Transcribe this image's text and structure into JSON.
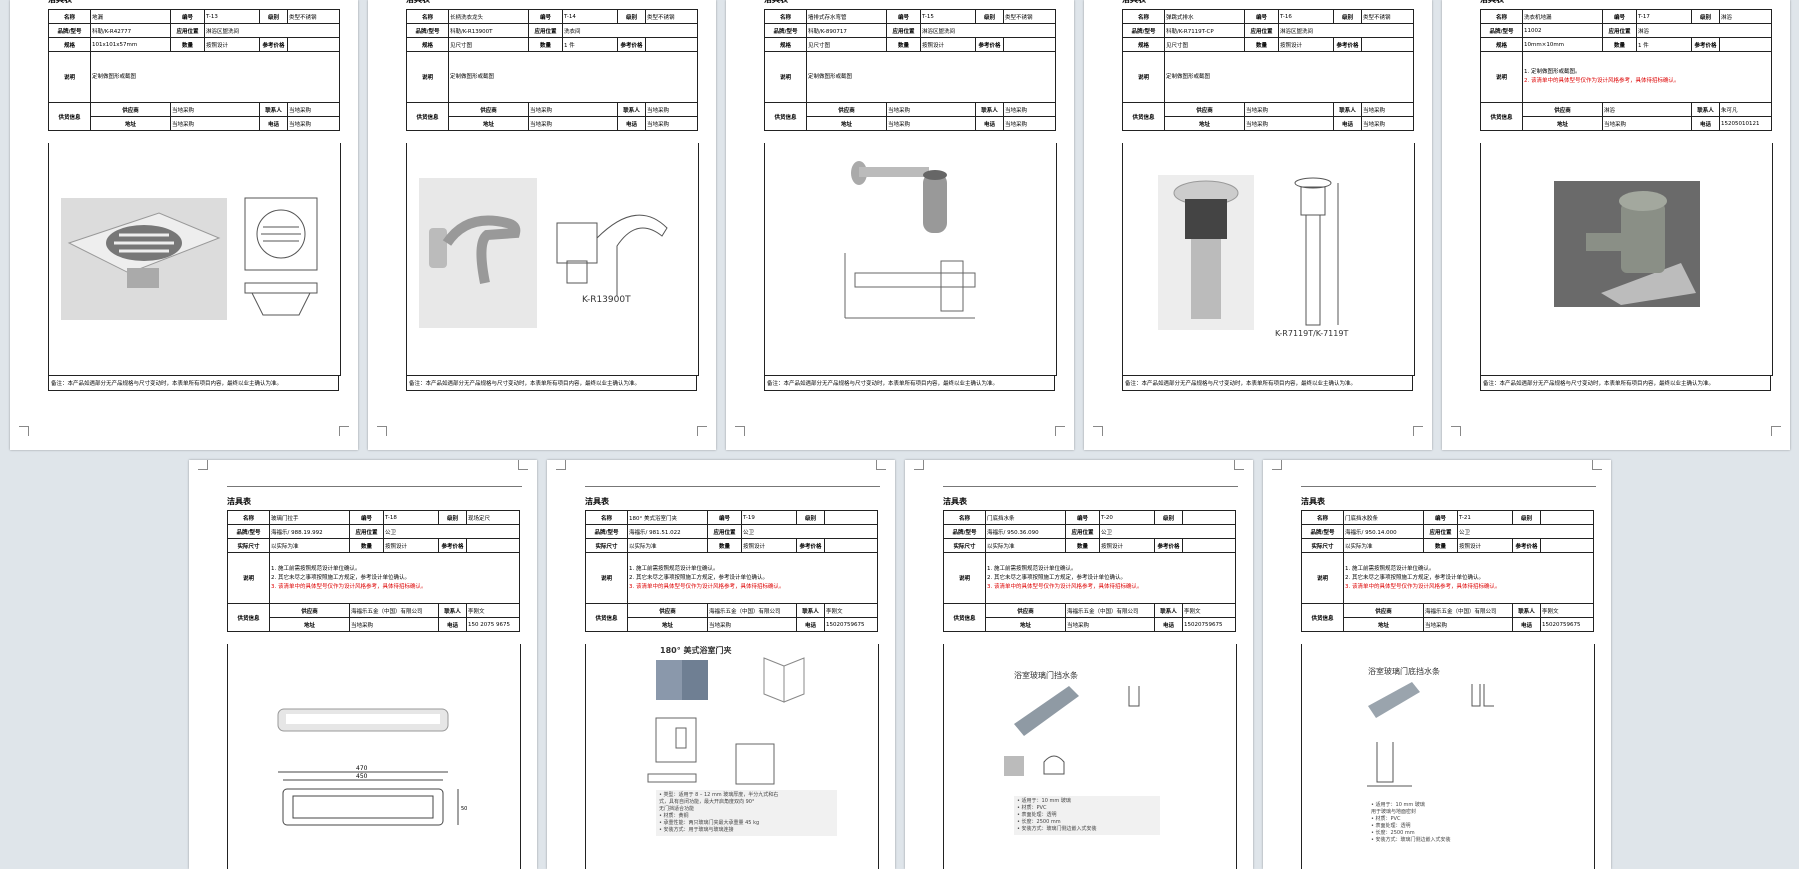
{
  "labels": {
    "name": "名称",
    "code": "编号",
    "grade": "级别",
    "model": "品牌/型号",
    "location": "应用位置",
    "size": "规格",
    "size_actual": "实际尺寸",
    "qty": "数量",
    "ref_price": "参考价格",
    "desc": "说明",
    "supplier": "供应商",
    "address": "地址",
    "contact": "联系人",
    "phone": "电话",
    "vendor_info": "供货信息",
    "doc_title": "洁具表"
  },
  "pages": [
    {
      "name": "地漏",
      "code": "T-13",
      "grade": "类型不锈钢",
      "model": "科勒/K-R42777",
      "location": "淋浴区盥洗间",
      "size": "101x101x57mm",
      "qty": "按照设计",
      "desc_lines": [
        "定制做图形或截图"
      ],
      "supplier": "当地采购",
      "contact": "当地采购",
      "address": "当地采购",
      "phone": "当地采购",
      "note": "备注：本产品如遇部分无产品规格与尺寸变动时，本表单所有项目内容，最终以业主确认为准。"
    },
    {
      "name": "长柄洗衣龙头",
      "code": "T-14",
      "grade": "类型不锈钢",
      "model": "科勒/K-R13900T",
      "location": "洗衣间",
      "size": "见尺寸图",
      "qty": "1 件",
      "desc_lines": [
        "定制做图形或截图"
      ],
      "supplier": "当地采购",
      "contact": "当地采购",
      "address": "当地采购",
      "phone": "当地采购",
      "caption": "K-R13900T",
      "note": "备注：本产品如遇部分无产品规格与尺寸变动时，本表单所有项目内容，最终以业主确认为准。"
    },
    {
      "name": "墙排式存水弯管",
      "code": "T-15",
      "grade": "类型不锈钢",
      "model": "科勒/K-890717",
      "location": "淋浴区盥洗间",
      "size": "见尺寸图",
      "qty": "按照设计",
      "desc_lines": [
        "定制做图形或截图"
      ],
      "supplier": "当地采购",
      "contact": "当地采购",
      "address": "当地采购",
      "phone": "当地采购",
      "note": "备注：本产品如遇部分无产品规格与尺寸变动时，本表单所有项目内容，最终以业主确认为准。"
    },
    {
      "name": "弹跳式排水",
      "code": "T-16",
      "grade": "类型不锈钢",
      "model": "科勒/K-R7119T-CP",
      "location": "淋浴区盥洗间",
      "size": "见尺寸图",
      "qty": "按照设计",
      "desc_lines": [
        "定制做图形或截图"
      ],
      "supplier": "当地采购",
      "contact": "当地采购",
      "address": "当地采购",
      "phone": "当地采购",
      "caption": "K-R7119T/K-7119T",
      "note": "备注：本产品如遇部分无产品规格与尺寸变动时，本表单所有项目内容，最终以业主确认为准。"
    },
    {
      "name": "洗衣机地漏",
      "code": "T-17",
      "grade": "淋浴",
      "model": "11002",
      "location": "淋浴",
      "size": "10mm×10mm",
      "qty": "1 件",
      "desc_lines": [
        "1. 定制做图形或截图。",
        "2. 该清单中的具体型号仅作为设计风格参考，具体待招标确认。"
      ],
      "supplier": "淋浴",
      "contact": "朱可凡",
      "address": "当地采购",
      "phone": "15205010121",
      "note": "备注：本产品如遇部分无产品规格与尺寸变动时，本表单所有项目内容，最终以业主确认为准。"
    },
    {
      "name": "玻璃门拉手",
      "code": "T-18",
      "grade": "现场定尺",
      "model": "海福乐/ 988.19.992",
      "location": "公卫",
      "size": "以实际为准",
      "qty": "按照设计",
      "desc_lines": [
        "1. 施工前需按照规范设计单位确认。",
        "2. 其它未尽之事项按照施工方规定，参考设计单位确认。",
        "3. 该清单中的具体型号仅作为设计风格参考，具体待招标确认。"
      ],
      "supplier": "海福乐五金（中国）有限公司",
      "contact": "李刚文",
      "address": "当地采购",
      "phone": "150 2075 9675",
      "note": ""
    },
    {
      "name": "180° 美式浴室门夹",
      "code": "T-19",
      "grade": "",
      "model": "海福乐/ 981.51.022",
      "location": "公卫",
      "size": "以实际为准",
      "qty": "按照设计",
      "desc_lines": [
        "1. 施工前需按照规范设计单位确认。",
        "2. 其它未尽之事项按照施工方规定，参考设计单位确认。",
        "3. 该清单中的具体型号仅作为设计风格参考，具体待招标确认。"
      ],
      "supplier": "海福乐五金（中国）有限公司",
      "contact": "李刚文",
      "address": "当地采购",
      "phone": "15020759675",
      "caption": "180° 美式浴室门夹",
      "spec_lines": [
        "• 类型：适用于 8 – 12 mm 玻璃厚度，半分九式和右",
        "         式，具有自闭功能，最大开启角度双向 90°",
        "         无门挡适合功能",
        "• 材质：黄铜",
        "• 承重性能：两只玻璃门夹最大承重量 45 kg",
        "• 安装方式：用于玻璃与玻璃连接"
      ],
      "note": ""
    },
    {
      "name": "门底挡水条",
      "code": "T-20",
      "grade": "",
      "model": "海福乐/ 950.36.090",
      "location": "公卫",
      "size": "以实际为准",
      "qty": "按照设计",
      "desc_lines": [
        "1. 施工前需按照规范设计单位确认。",
        "2. 其它未尽之事项按照施工方规定，参考设计单位确认。",
        "3. 该清单中的具体型号仅作为设计风格参考，具体待招标确认。"
      ],
      "supplier": "海福乐五金（中国）有限公司",
      "contact": "李刚文",
      "address": "当地采购",
      "phone": "15020759675",
      "caption": "浴室玻璃门挡水条",
      "spec_lines": [
        "• 适用于：10 mm 玻璃",
        "• 材质：PVC",
        "• 表面处理：透明",
        "• 长度：2500 mm",
        "• 安装方式：玻璃门侧边嵌入式安装"
      ],
      "note": ""
    },
    {
      "name": "门底挡水胶条",
      "code": "T-21",
      "grade": "",
      "model": "海福乐/ 950.14.000",
      "location": "公卫",
      "size": "以实际为准",
      "qty": "按照设计",
      "desc_lines": [
        "1. 施工前需按照规范设计单位确认。",
        "2. 其它未尽之事项按照施工方规定，参考设计单位确认。",
        "3. 该清单中的具体型号仅作为设计风格参考，具体待招标确认。"
      ],
      "supplier": "海福乐五金（中国）有限公司",
      "contact": "李刚文",
      "address": "当地采购",
      "phone": "15020759675",
      "caption": "浴室玻璃门底挡水条",
      "spec_lines": [
        "• 适用于：10 mm 玻璃",
        "         用于玻璃与地面密封",
        "• 材质：PVC",
        "• 表面处理：透明",
        "• 长度：2500 mm",
        "• 安装方式：玻璃门侧边嵌入式安装"
      ],
      "note": ""
    }
  ]
}
